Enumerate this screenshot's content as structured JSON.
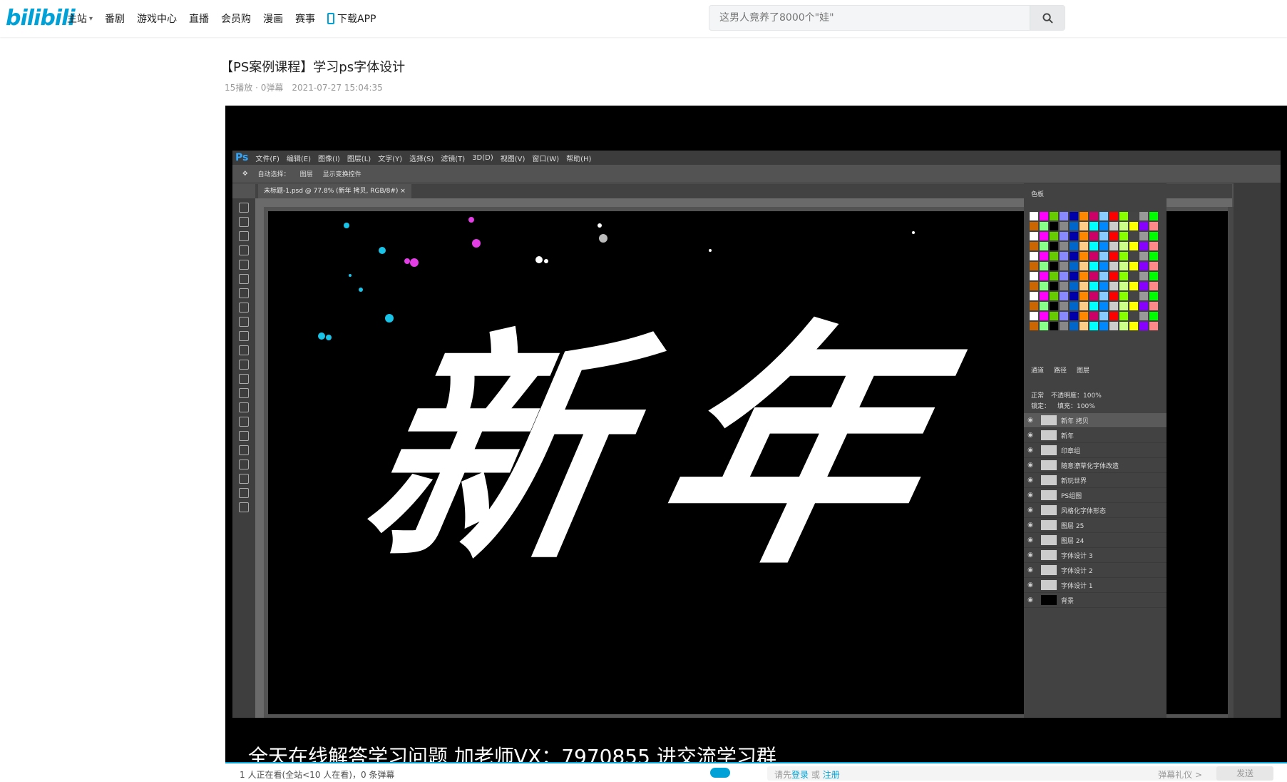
{
  "header": {
    "logo": "bilibili",
    "nav": [
      {
        "label": "主站",
        "dropdown": true
      },
      {
        "label": "番剧"
      },
      {
        "label": "游戏中心"
      },
      {
        "label": "直播"
      },
      {
        "label": "会员购"
      },
      {
        "label": "漫画"
      },
      {
        "label": "赛事"
      },
      {
        "label": "下载APP"
      }
    ],
    "search_placeholder": "这男人竟养了8000个\"娃\""
  },
  "video": {
    "title": "【PS案例课程】学习ps字体设计",
    "stats": "15播放 · 0弹幕",
    "date": "2021-07-27 15:04:35"
  },
  "photoshop": {
    "menus": [
      "文件(F)",
      "编辑(E)",
      "图像(I)",
      "图层(L)",
      "文字(Y)",
      "选择(S)",
      "滤镜(T)",
      "3D(D)",
      "视图(V)",
      "窗口(W)",
      "帮助(H)"
    ],
    "options": [
      "自动选择：",
      "图层",
      "显示变换控件"
    ],
    "tab": "未标题-1.psd @ 77.8% (新年 拷贝, RGB/8#) ×",
    "swatch_label": "色板",
    "layer_tabs": [
      "通道",
      "路径",
      "图层"
    ],
    "layer_controls": [
      "正常",
      "不透明度：100%",
      "锁定：",
      "填充：100%"
    ],
    "layers": [
      "新年 拷贝",
      "新年",
      "印章组",
      "随意潦草化字体改造",
      "新玩世界",
      "PS组图",
      "风格化字体形态",
      "图层 25",
      "图层 24",
      "字体设计 3",
      "字体设计 2",
      "字体设计 1",
      "背景"
    ],
    "canvas_text": [
      "新",
      "年"
    ],
    "colors": {
      "canvas": "#000000",
      "ui": "#535353",
      "accent": "#31a8ff"
    }
  },
  "subtitle": "全天在线解答学习问题  加老师VX：7970855   进交流学习群",
  "bottom": {
    "viewers": "1 人正在看(全站<10 人在看)，0 条弹幕",
    "input_prefix": "请先",
    "login": "登录",
    "or": "或",
    "register": "注册",
    "etiquette": "弹幕礼仪 >",
    "send": "发送"
  },
  "colors": {
    "brand": "#00a1d6"
  }
}
